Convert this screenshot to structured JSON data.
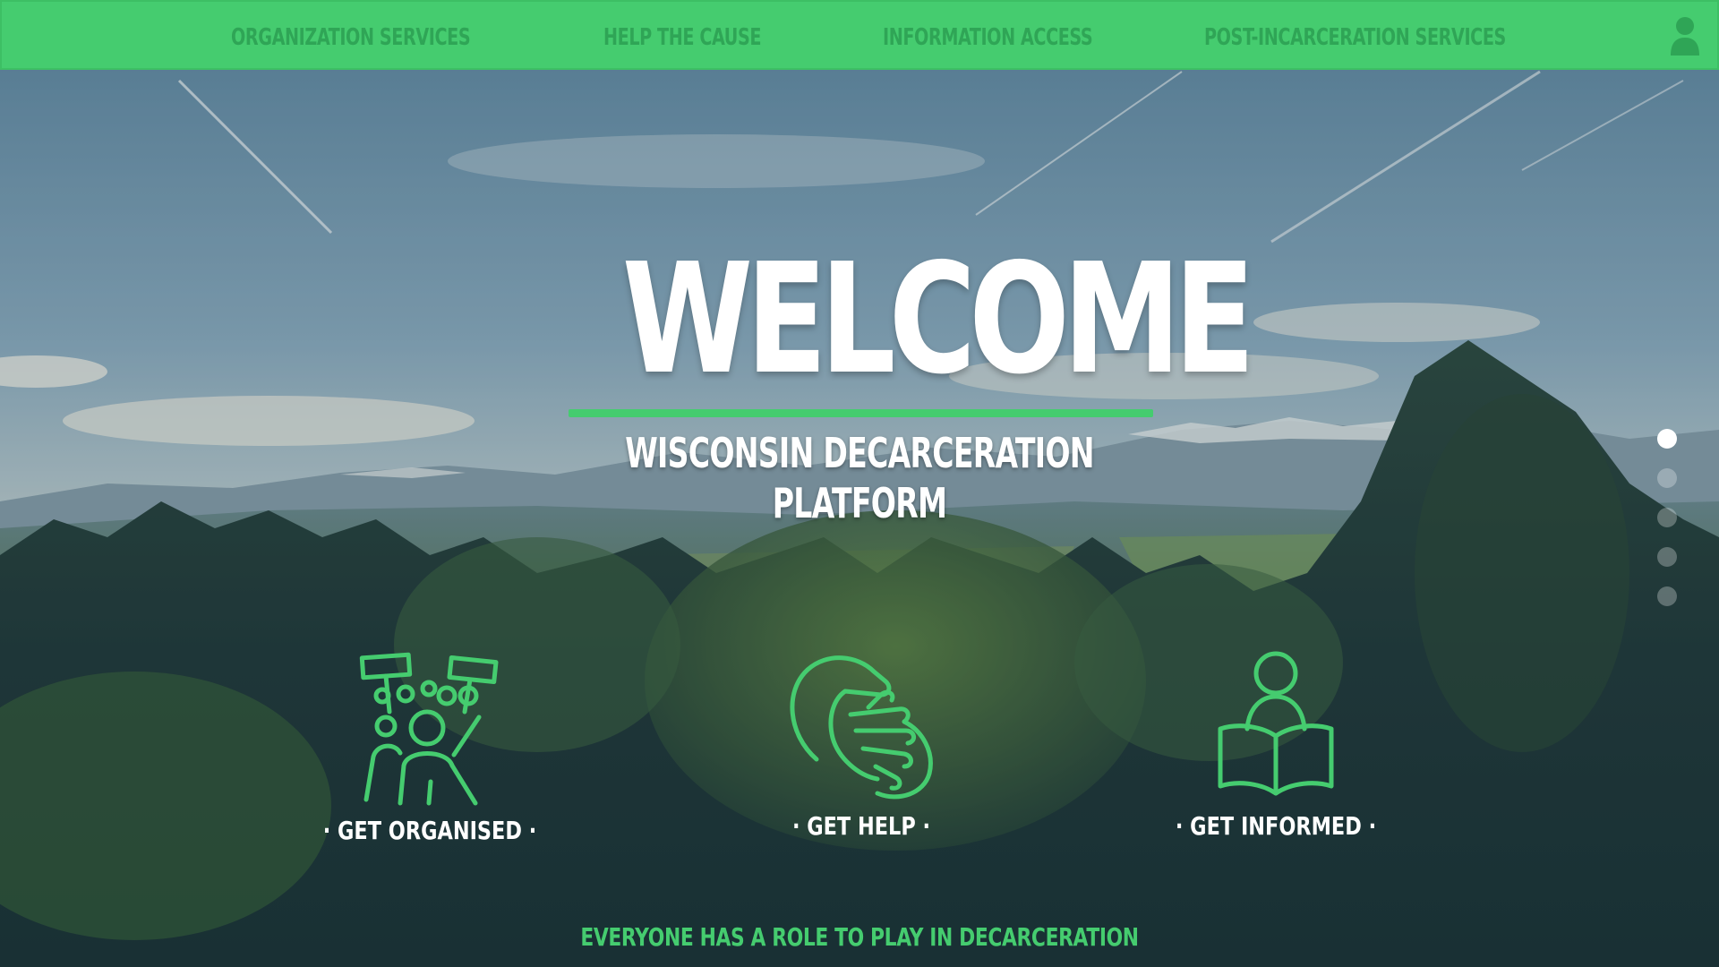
{
  "nav": {
    "items": [
      {
        "label": "ORGANIZATION SERVICES"
      },
      {
        "label": "HELP THE CAUSE"
      },
      {
        "label": "INFORMATION ACCESS"
      },
      {
        "label": "POST-INCARCERATION SERVICES"
      }
    ],
    "user_icon": "user-icon"
  },
  "hero": {
    "title": "WELCOME",
    "subtitle": "WISCONSIN DECARCERATION PLATFORM"
  },
  "carousel": {
    "dot_count": 5,
    "active_index": 0
  },
  "actions": [
    {
      "label": "· GET ORGANISED ·",
      "icon": "protest-crowd-icon"
    },
    {
      "label": "· GET HELP ·",
      "icon": "helping-hands-icon"
    },
    {
      "label": "· GET INFORMED ·",
      "icon": "reader-book-icon"
    }
  ],
  "tagline": "EVERYONE HAS A ROLE TO PLAY IN DECARCERATION",
  "colors": {
    "accent": "#45cc6f",
    "nav_text": "#2fa556",
    "hero_text": "#ffffff"
  }
}
